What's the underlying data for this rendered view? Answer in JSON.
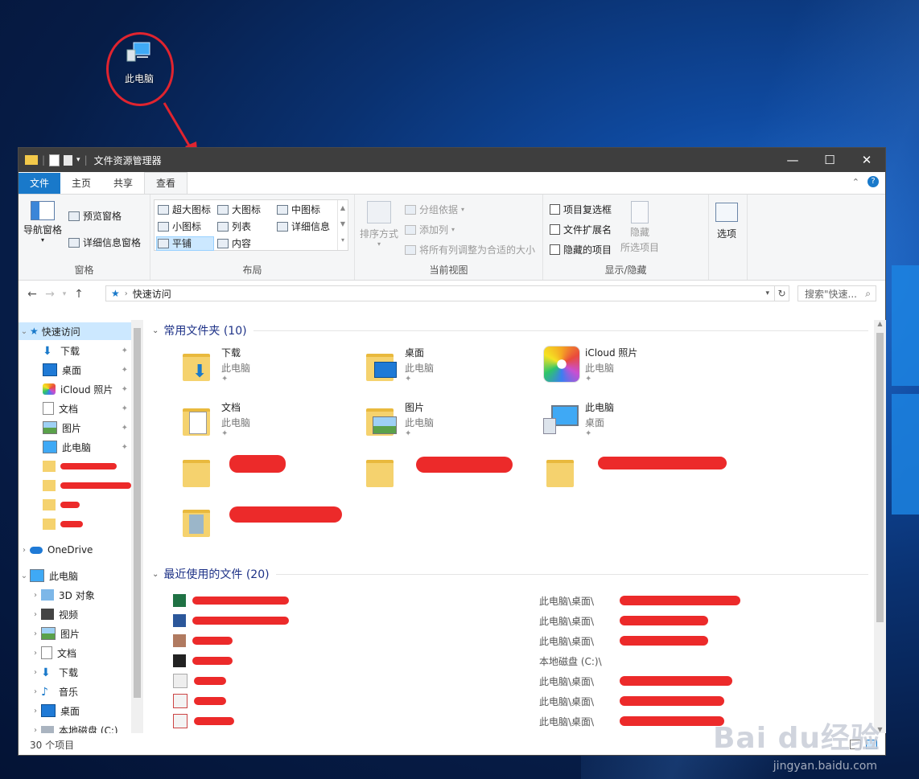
{
  "desktop": {
    "icon_label": "此电脑"
  },
  "window": {
    "title": "文件资源管理器",
    "controls": {
      "minimize": "—",
      "maximize": "☐",
      "close": "✕"
    }
  },
  "tabs": [
    "文件",
    "主页",
    "共享",
    "查看"
  ],
  "ribbon": {
    "pane": {
      "nav_pane": "导航窗格",
      "preview_pane": "预览窗格",
      "details_pane": "详细信息窗格",
      "label": "窗格"
    },
    "layout": {
      "items": [
        "超大图标",
        "大图标",
        "中图标",
        "小图标",
        "列表",
        "详细信息",
        "平铺",
        "内容"
      ],
      "label": "布局"
    },
    "current_view": {
      "sort": "排序方式",
      "group": "分组依据",
      "add_columns": "添加列",
      "fit_columns": "将所有列调整为合适的大小",
      "label": "当前视图"
    },
    "show_hide": {
      "item_checkboxes": "项目复选框",
      "file_ext": "文件扩展名",
      "hidden_items": "隐藏的项目",
      "hide_selected_1": "隐藏",
      "hide_selected_2": "所选项目",
      "label": "显示/隐藏"
    },
    "options": "选项"
  },
  "address": {
    "path": "快速访问",
    "search_placeholder": "搜索\"快速..."
  },
  "sidebar": {
    "quick_access": "快速访问",
    "qa_items": [
      "下载",
      "桌面",
      "iCloud 照片",
      "文档",
      "图片",
      "此电脑"
    ],
    "onedrive": "OneDrive",
    "this_pc": "此电脑",
    "pc_items": [
      "3D 对象",
      "视频",
      "图片",
      "文档",
      "下载",
      "音乐",
      "桌面",
      "本地磁盘 (C:)"
    ]
  },
  "main": {
    "frequent_header": "常用文件夹 (10)",
    "frequent": [
      {
        "name": "下载",
        "sub": "此电脑"
      },
      {
        "name": "桌面",
        "sub": "此电脑"
      },
      {
        "name": "iCloud 照片",
        "sub": "此电脑"
      },
      {
        "name": "文档",
        "sub": "此电脑"
      },
      {
        "name": "图片",
        "sub": "此电脑"
      },
      {
        "name": "此电脑",
        "sub": "桌面"
      }
    ],
    "recent_header": "最近使用的文件 (20)",
    "recent_paths": [
      "此电脑\\桌面\\",
      "此电脑\\桌面\\",
      "此电脑\\桌面\\",
      "本地磁盘 (C:)\\",
      "此电脑\\桌面\\",
      "此电脑\\桌面\\",
      "此电脑\\桌面\\"
    ]
  },
  "status": {
    "count": "30 个项目"
  },
  "watermark": {
    "main": "Bai du经验",
    "url": "jingyan.baidu.com"
  }
}
